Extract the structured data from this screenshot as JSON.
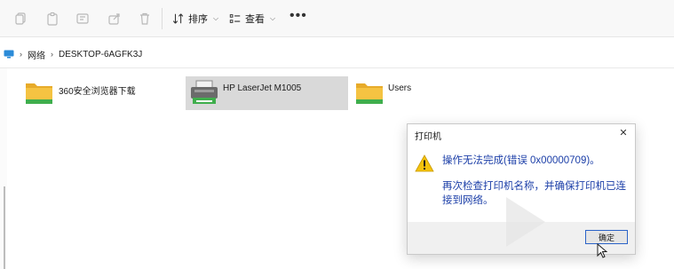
{
  "toolbar": {
    "sort_label": "排序",
    "view_label": "查看",
    "more_label": "•••"
  },
  "address": {
    "crumbs": [
      "网络",
      "DESKTOP-6AGFK3J"
    ]
  },
  "items": [
    {
      "label": "360安全浏览器下载",
      "icon": "folder-icon"
    },
    {
      "label": "HP LaserJet M1005",
      "icon": "printer-icon"
    },
    {
      "label": "Users",
      "icon": "folder-icon"
    }
  ],
  "dialog": {
    "title": "打印机",
    "close": "✕",
    "message1": "操作无法完成(错误 0x00000709)。",
    "message2": "再次检查打印机名称，并确保打印机已连接到网络。",
    "ok_label": "确定"
  },
  "colors": {
    "folder": "#f5c342",
    "folder_tab": "#e7ab2a",
    "green_band": "#3fae4c",
    "message_text": "#1c3fa8",
    "selected_item": "#d9d9d9",
    "ok_border": "#2b63c8"
  }
}
